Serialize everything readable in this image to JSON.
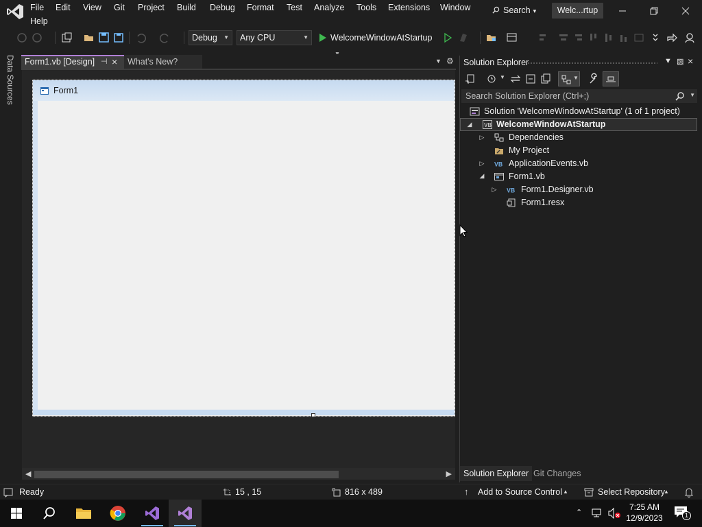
{
  "window": {
    "menu": [
      "File",
      "Edit",
      "View",
      "Git",
      "Project",
      "Build",
      "Debug",
      "Format",
      "Test",
      "Analyze",
      "Tools",
      "Extensions",
      "Window",
      "Help"
    ],
    "search_label": "Search",
    "solution_badge": "Welc...rtup"
  },
  "toolbar": {
    "config": "Debug",
    "platform": "Any CPU",
    "startup_project": "WelcomeWindowAtStartup"
  },
  "left_tabs": {
    "data_sources": "Data Sources"
  },
  "editor": {
    "tabs": [
      {
        "label": "Form1.vb [Design]",
        "active": true
      },
      {
        "label": "What's New?",
        "active": false
      }
    ],
    "form": {
      "title": "Form1"
    }
  },
  "solution_explorer": {
    "title": "Solution Explorer",
    "search_placeholder": "Search Solution Explorer (Ctrl+;)",
    "tree": [
      {
        "label": "Solution 'WelcomeWindowAtStartup' (1 of 1 project)",
        "icon": "solution-icon",
        "expander": ""
      },
      {
        "label": "WelcomeWindowAtStartup",
        "icon": "vb-project-icon",
        "expander": "expanded",
        "selected": true
      },
      {
        "label": "Dependencies",
        "icon": "dependencies-icon",
        "expander": "collapsed"
      },
      {
        "label": "My Project",
        "icon": "wrench-folder-icon",
        "expander": ""
      },
      {
        "label": "ApplicationEvents.vb",
        "icon": "vb-file-icon",
        "expander": "collapsed"
      },
      {
        "label": "Form1.vb",
        "icon": "form-file-icon",
        "expander": "expanded"
      },
      {
        "label": "Form1.Designer.vb",
        "icon": "vb-file-icon",
        "expander": "collapsed"
      },
      {
        "label": "Form1.resx",
        "icon": "resource-file-icon",
        "expander": ""
      }
    ],
    "bottom_tabs": [
      "Solution Explorer",
      "Git Changes"
    ]
  },
  "status_bar": {
    "state": "Ready",
    "position": "15 , 15",
    "size": "816 x 489",
    "source_control": "Add to Source Control",
    "repository": "Select Repository"
  },
  "taskbar": {
    "time": "7:25 AM",
    "date": "12/9/2023",
    "notification_count": "1"
  },
  "colors": {
    "accent": "#b180d7",
    "background": "#1f1f1f",
    "form_client": "#f0f0f0",
    "form_titlebar": "#c6daf0",
    "run_green": "#3fb950"
  }
}
